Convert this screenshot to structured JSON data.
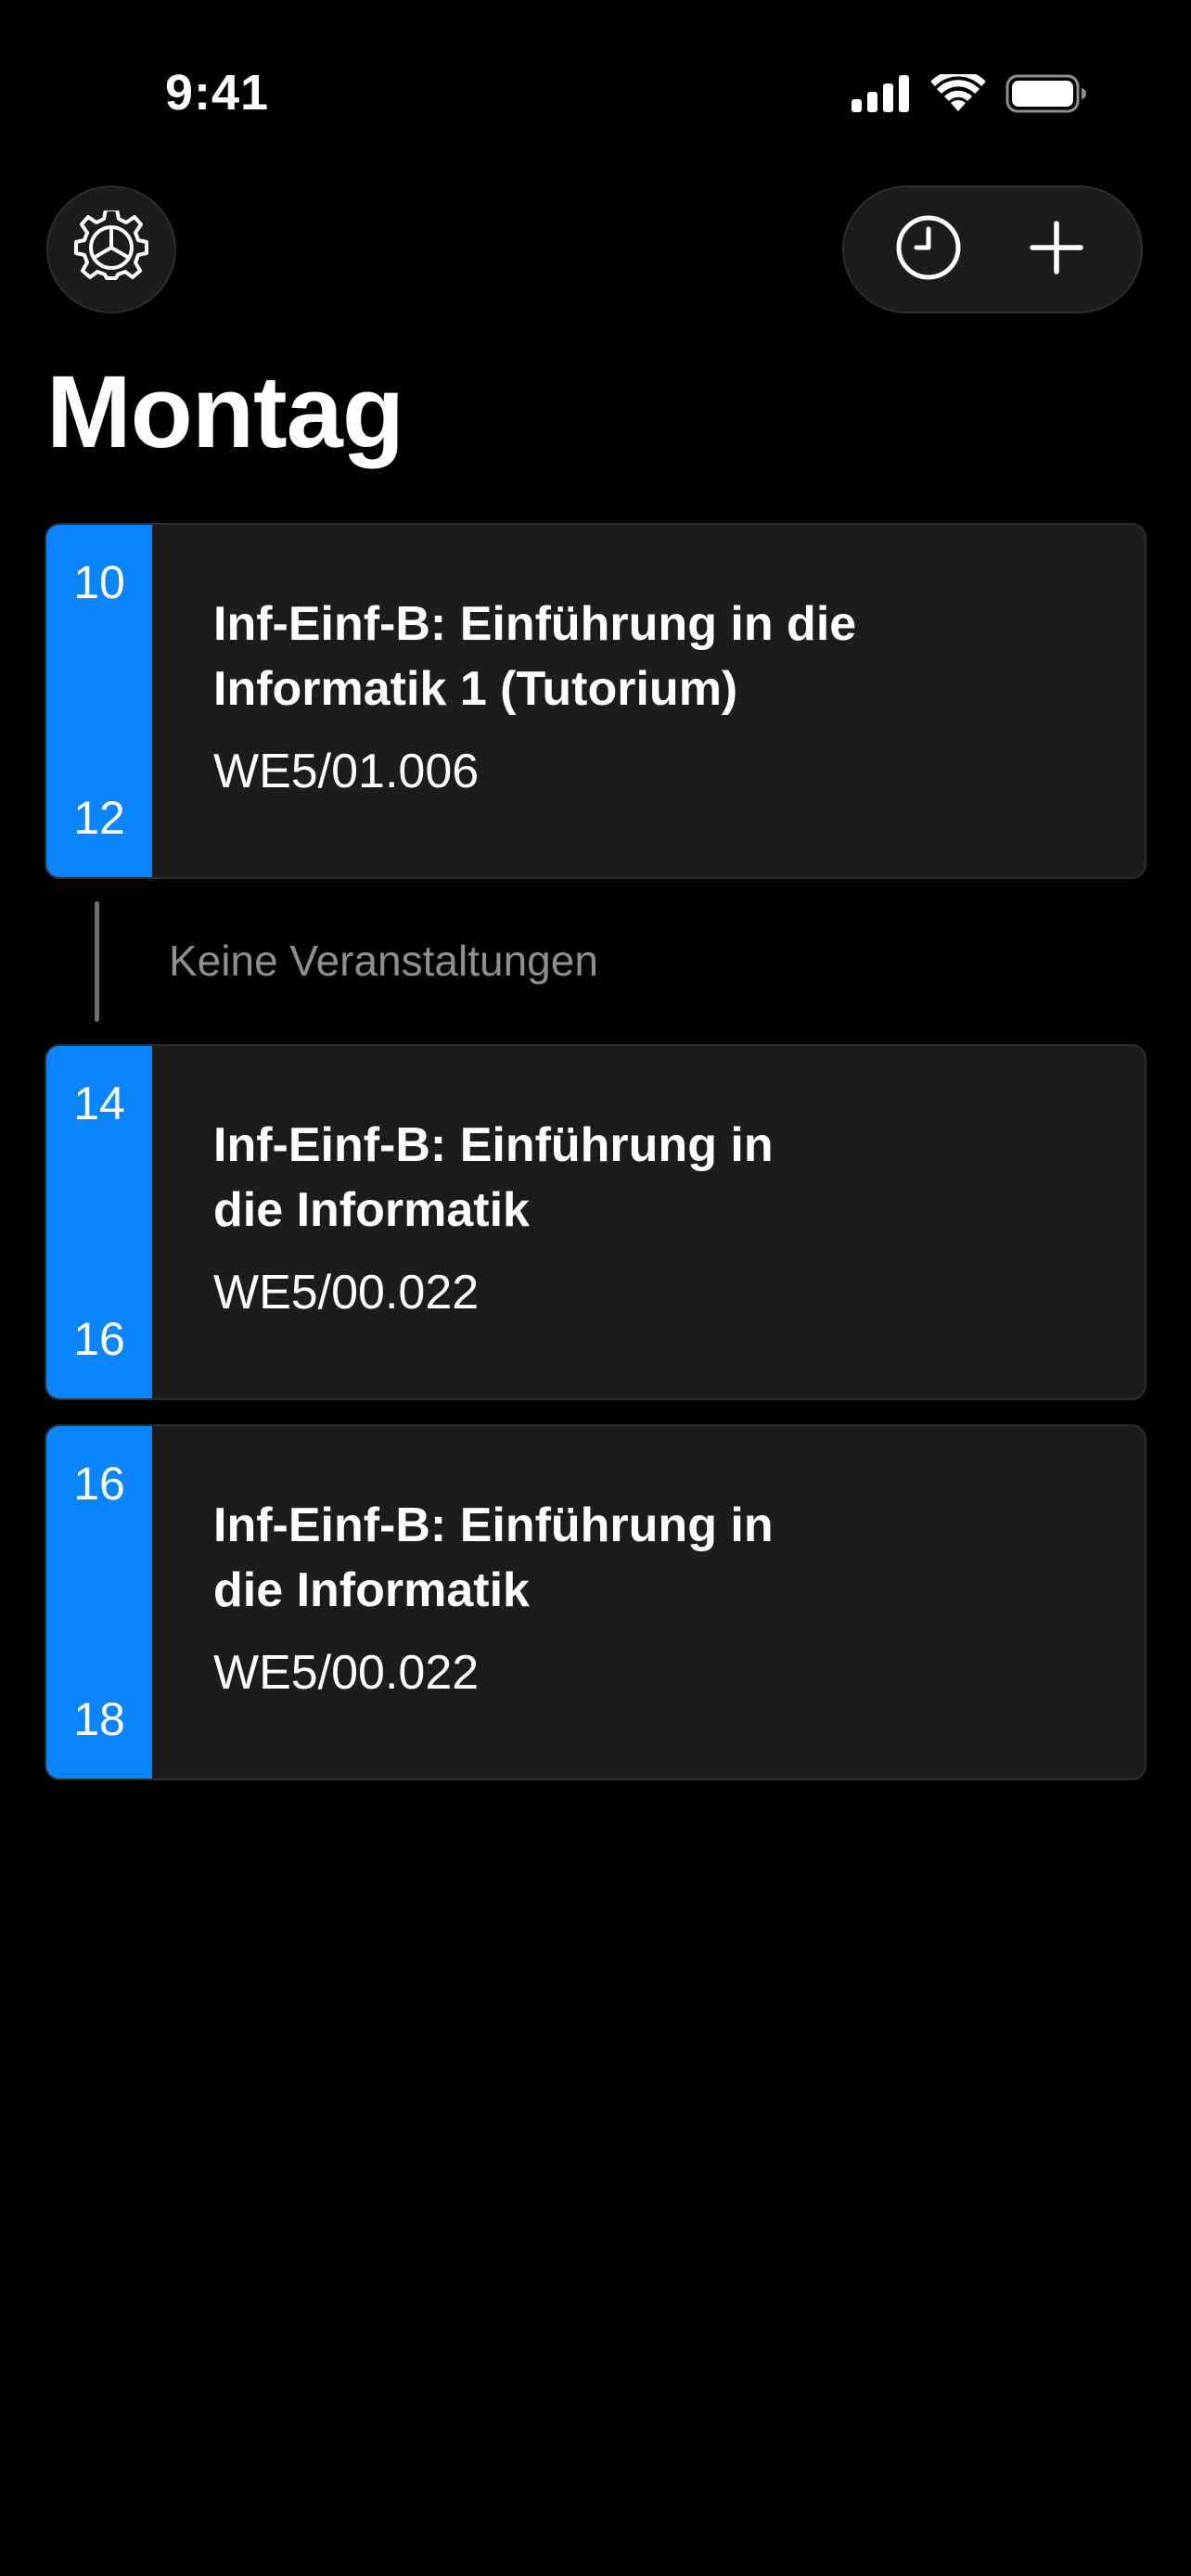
{
  "status_bar": {
    "time": "9:41",
    "icons": [
      "cellular-signal-icon",
      "wifi-icon",
      "battery-icon"
    ]
  },
  "toolbar": {
    "settings_icon": "gear-icon",
    "history_icon": "clock-icon",
    "add_icon": "plus-icon"
  },
  "page": {
    "title": "Montag"
  },
  "colors": {
    "accent": "#0a84ff",
    "card_background": "#1c1c1e",
    "background": "#000000",
    "secondary_text": "#8e8e93"
  },
  "events": [
    {
      "start": "10",
      "end": "12",
      "title_line1": "Inf-Einf-B: Einführung in die",
      "title_line2": "Informatik 1 (Tutorium)",
      "room": "WE5/01.006"
    },
    {
      "start": "14",
      "end": "16",
      "title_line1": "Inf-Einf-B: Einführung in",
      "title_line2": "die Informatik",
      "room": "WE5/00.022"
    },
    {
      "start": "16",
      "end": "18",
      "title_line1": "Inf-Einf-B: Einführung in",
      "title_line2": "die Informatik",
      "room": "WE5/00.022"
    }
  ],
  "gap": {
    "label": "Keine Veranstaltungen"
  }
}
